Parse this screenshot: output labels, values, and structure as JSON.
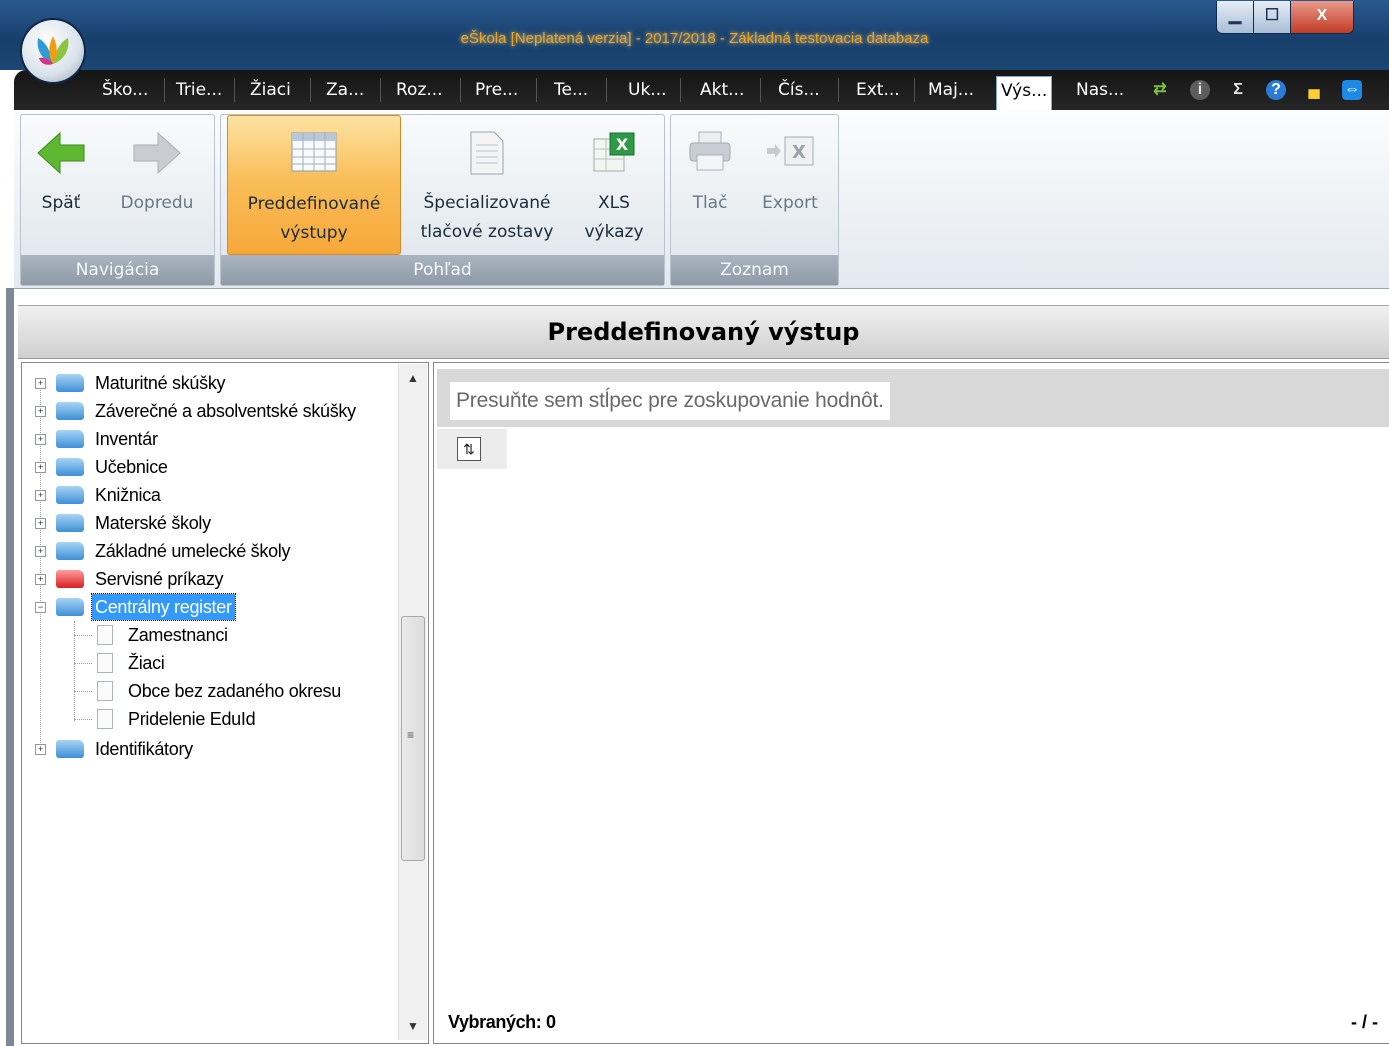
{
  "window": {
    "title": "eŠkola [Neplatená verzia] - 2017/2018 - Základná testovacia databaza",
    "minimize_label": "▁",
    "maximize_label": "☐",
    "close_label": "X"
  },
  "menu": {
    "tabs": [
      {
        "label": "Ško..."
      },
      {
        "label": "Trie..."
      },
      {
        "label": "Žiaci"
      },
      {
        "label": "Za..."
      },
      {
        "label": "Roz..."
      },
      {
        "label": "Pre..."
      },
      {
        "label": "Te..."
      },
      {
        "label": "Uk..."
      },
      {
        "label": "Akt..."
      },
      {
        "label": "Čís..."
      },
      {
        "label": "Ext..."
      },
      {
        "label": "Maj..."
      },
      {
        "label": "Výs...",
        "active": true
      },
      {
        "label": "Nas..."
      }
    ],
    "icons": [
      "refresh-icon",
      "info-icon",
      "sum-icon",
      "help-icon",
      "cake-icon",
      "teamviewer-icon"
    ]
  },
  "ribbon": {
    "groups": [
      {
        "label": "Navigácia",
        "buttons": [
          {
            "label": "Späť",
            "icon": "back-arrow-icon"
          },
          {
            "label": "Dopredu",
            "icon": "forward-arrow-icon",
            "disabled": true
          }
        ]
      },
      {
        "label": "Pohľad",
        "buttons": [
          {
            "label": "Preddefinované\nvýstupy",
            "icon": "table-icon",
            "selected": true
          },
          {
            "label": "Špecializované\ntlačové zostavy",
            "icon": "document-icon"
          },
          {
            "label": "XLS\nvýkazy",
            "icon": "excel-icon"
          }
        ]
      },
      {
        "label": "Zoznam",
        "buttons": [
          {
            "label": "Tlač",
            "icon": "printer-icon",
            "disabled": true
          },
          {
            "label": "Export",
            "icon": "export-icon",
            "disabled": true
          }
        ]
      }
    ]
  },
  "section": {
    "title": "Preddefinovaný výstup"
  },
  "tree": {
    "nodes": [
      {
        "label": "Maturitné skúšky",
        "expanded": false,
        "color": "blue"
      },
      {
        "label": "Záverečné a absolventské skúšky",
        "expanded": false,
        "color": "blue"
      },
      {
        "label": "Inventár",
        "expanded": false,
        "color": "blue"
      },
      {
        "label": "Učebnice",
        "expanded": false,
        "color": "blue"
      },
      {
        "label": "Knižnica",
        "expanded": false,
        "color": "blue"
      },
      {
        "label": "Materské školy",
        "expanded": false,
        "color": "blue"
      },
      {
        "label": "Základné umelecké školy",
        "expanded": false,
        "color": "blue"
      },
      {
        "label": "Servisné príkazy",
        "expanded": false,
        "color": "red"
      },
      {
        "label": "Centrálny register",
        "expanded": true,
        "color": "blue",
        "selected": true,
        "children": [
          {
            "label": "Zamestnanci"
          },
          {
            "label": "Žiaci"
          },
          {
            "label": "Obce bez zadaného okresu"
          },
          {
            "label": "Pridelenie EduId"
          }
        ]
      },
      {
        "label": "Identifikátory",
        "expanded": false,
        "color": "blue"
      }
    ]
  },
  "grid": {
    "group_hint": "Presuňte sem stĺpec pre zoskupovanie hodnôt.",
    "selected_label": "Vybraných: 0",
    "pager": "- / -"
  },
  "colors": {
    "title_accent": "#f2a41c",
    "selected_ribbon": "#f9be59",
    "tree_selection": "#3399ff"
  }
}
